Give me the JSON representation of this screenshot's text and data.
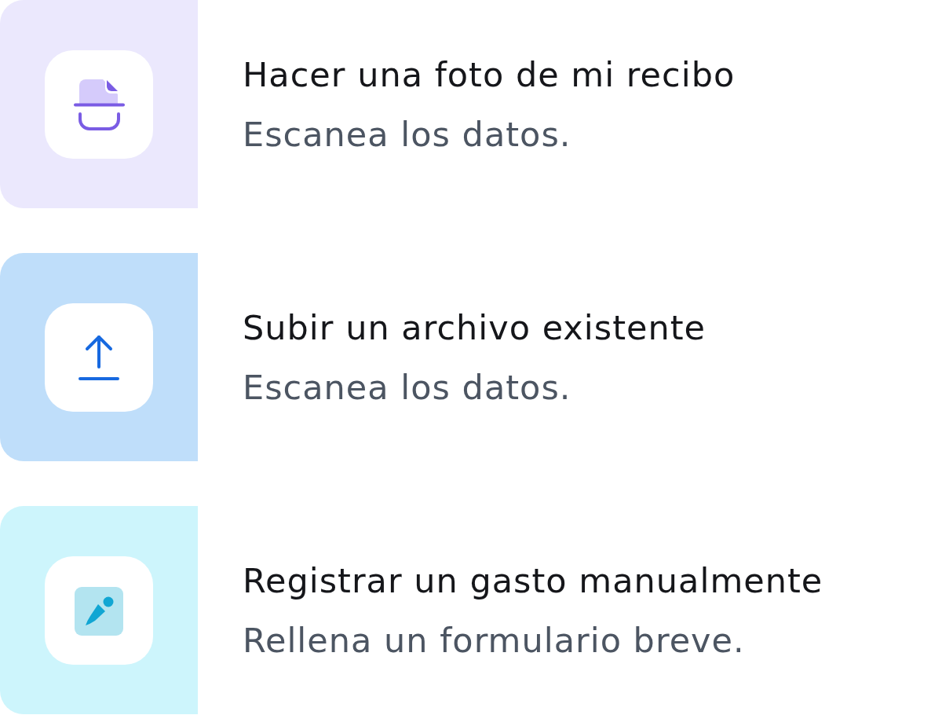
{
  "options": [
    {
      "kind": "scan",
      "color": "#ebe8fd",
      "title": "Hacer una foto de mi recibo",
      "description": "Escanea los datos."
    },
    {
      "kind": "upload",
      "color": "#bfdefa",
      "title": "Subir un archivo existente",
      "description": "Escanea los datos."
    },
    {
      "kind": "manual",
      "color": "#cdf5fc",
      "title": "Registrar un gasto manualmente",
      "description": "Rellena un formulario breve."
    }
  ]
}
